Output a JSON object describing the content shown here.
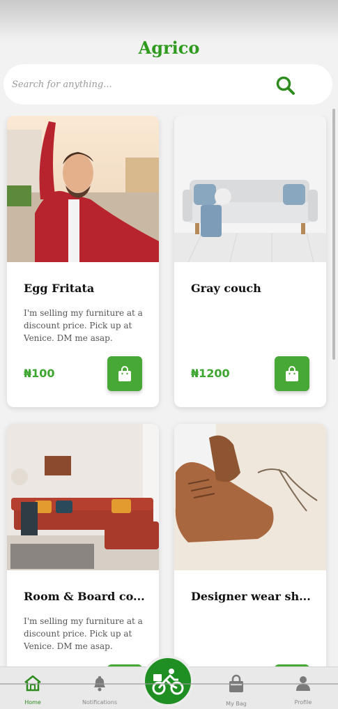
{
  "app": {
    "title": "Agrico"
  },
  "search": {
    "placeholder": "Search for anything..."
  },
  "products": [
    {
      "title": "Egg Fritata",
      "description": "I'm selling my furniture at a discount price. Pick up at Venice. DM me asap.",
      "price": "₦100"
    },
    {
      "title": "Gray couch",
      "description": "",
      "price": "₦1200"
    },
    {
      "title": "Room & Board co...",
      "description": "I'm selling my furniture at a discount price. Pick up at Venice. DM me asap.",
      "price": ""
    },
    {
      "title": "Designer wear sh...",
      "description": "",
      "price": ""
    }
  ],
  "nav": {
    "home": "Home",
    "notifications": "Notifications",
    "my_bag": "My Bag",
    "profile": "Profile"
  },
  "colors": {
    "accent": "#47a835",
    "brand_dark": "#1f8f24"
  },
  "icons": [
    "search-icon",
    "shopping-bag-icon",
    "home-icon",
    "bell-icon",
    "bicycle-delivery-icon",
    "bag-icon",
    "user-icon"
  ]
}
